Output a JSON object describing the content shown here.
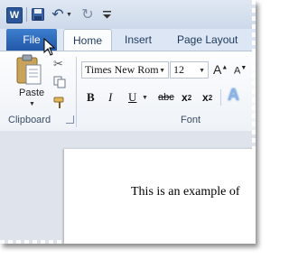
{
  "quick_access": {
    "app_icon_letter": "W",
    "icons": [
      "word-app-icon",
      "save-icon",
      "undo-icon",
      "redo-icon",
      "customize-quick-access-icon"
    ]
  },
  "tabs": {
    "file": "File",
    "home": "Home",
    "insert": "Insert",
    "page_layout": "Page Layout"
  },
  "clipboard": {
    "paste_label": "Paste",
    "group_label": "Clipboard"
  },
  "font": {
    "name": "Times New Rom",
    "size": "12",
    "bold": "B",
    "italic": "I",
    "underline": "U",
    "strikethrough": "abc",
    "subscript_base": "x",
    "subscript_mark": "2",
    "superscript_base": "x",
    "superscript_mark": "2",
    "text_effect": "A",
    "group_label": "Font"
  },
  "document": {
    "text": "This is an example of"
  },
  "colors": {
    "file_tab": "#2b6cc4",
    "accent": "#2b579a",
    "ribbon_bg": "#f8fafc"
  }
}
